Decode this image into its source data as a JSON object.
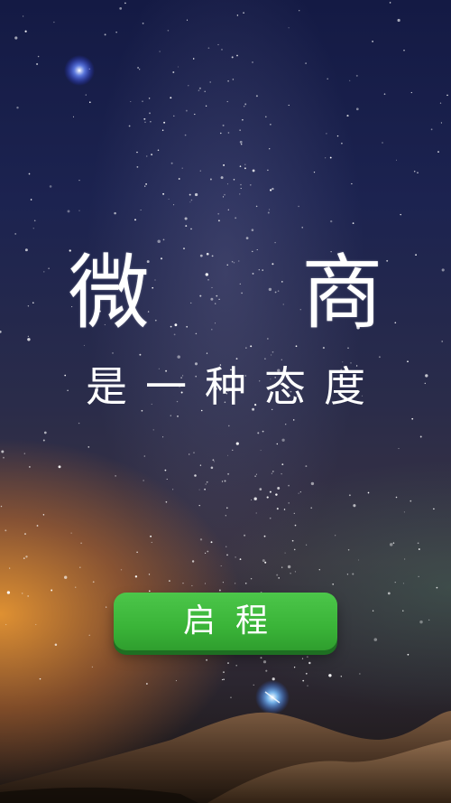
{
  "screen": {
    "title": "微 商",
    "subtitle": "是一种态度",
    "start_button_label": "启程"
  },
  "colors": {
    "button_green": "#3ab438",
    "button_shadow": "#1e6f22",
    "text": "#ffffff",
    "glow_orange": "#e89632"
  }
}
